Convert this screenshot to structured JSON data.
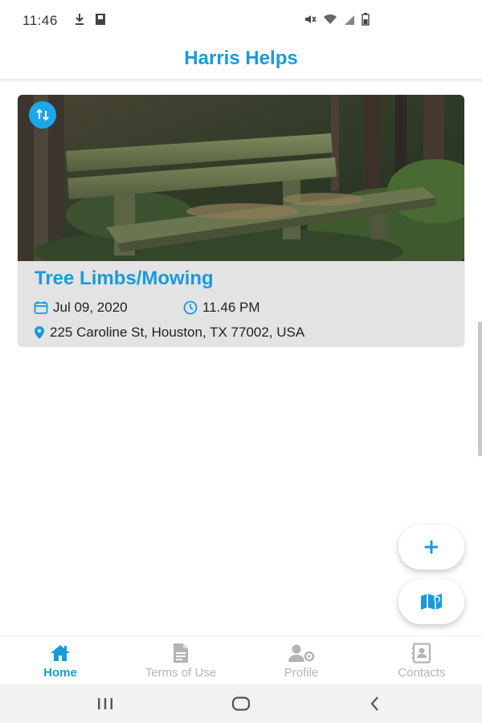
{
  "status_bar": {
    "time": "11:46",
    "left_icons": [
      "download-icon",
      "sd-card-icon"
    ],
    "right_icons": [
      "mute-icon",
      "wifi-icon",
      "signal-icon",
      "battery-icon"
    ]
  },
  "header": {
    "title": "Harris Helps"
  },
  "card": {
    "image_icon": "swap-icon",
    "title": "Tree Limbs/Mowing",
    "date": "Jul 09, 2020",
    "time": "11.46 PM",
    "address": "225 Caroline St, Houston, TX 77002, USA"
  },
  "fabs": {
    "add_icon": "plus-icon",
    "map_icon": "map-icon"
  },
  "bottom_nav": {
    "items": [
      {
        "label": "Home",
        "icon": "home-icon",
        "active": true
      },
      {
        "label": "Terms of Use",
        "icon": "document-icon",
        "active": false
      },
      {
        "label": "Profile",
        "icon": "profile-settings-icon",
        "active": false
      },
      {
        "label": "Contacts",
        "icon": "contacts-icon",
        "active": false
      }
    ]
  },
  "system_nav": {
    "buttons": [
      "recents-button",
      "home-button",
      "back-button"
    ]
  },
  "colors": {
    "accent": "#1a9ad9",
    "badge": "#1ea7e8",
    "card_bg": "#e3e3e3",
    "inactive": "#b4b4b4",
    "system_bar": "#f2f2f2"
  }
}
